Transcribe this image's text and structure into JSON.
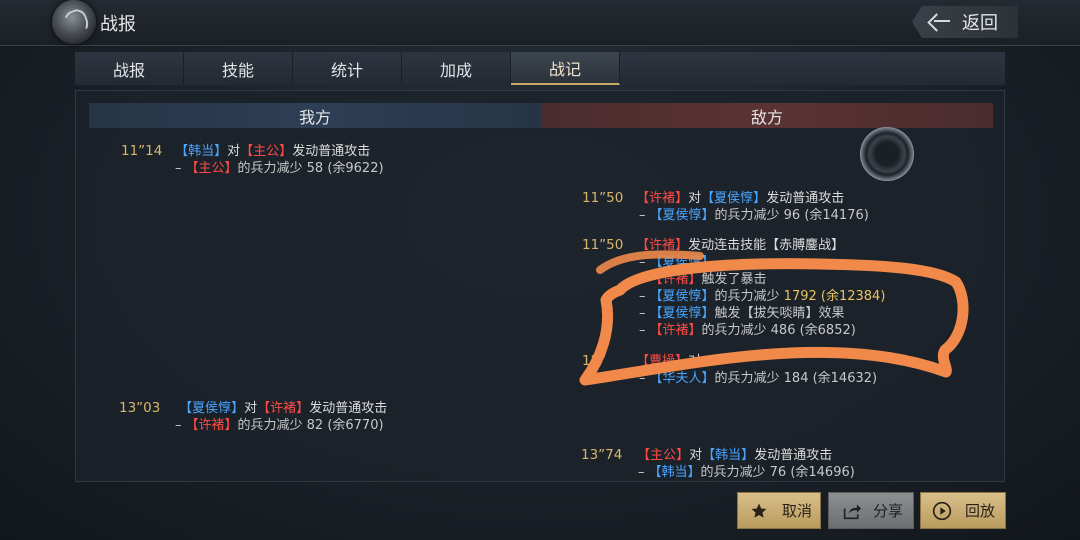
{
  "header": {
    "title": "战报",
    "back_label": "返回"
  },
  "tabs": [
    {
      "label": "战报",
      "active": false
    },
    {
      "label": "技能",
      "active": false
    },
    {
      "label": "统计",
      "active": false
    },
    {
      "label": "加成",
      "active": false
    },
    {
      "label": "战记",
      "active": true
    }
  ],
  "sides": {
    "ours": "我方",
    "enemy": "敌方"
  },
  "log": {
    "e1": {
      "time": "11”14",
      "l1": {
        "a": "【韩当】",
        "b": "对",
        "c": "【主公】",
        "d": "发动普通攻击"
      },
      "l2": {
        "dash": "–",
        "a": "【主公】",
        "b": "的兵力减少 58 (余9622)"
      }
    },
    "e2": {
      "time": "11”50",
      "l1": {
        "a": "【许褚】",
        "b": "对",
        "c": "【夏侯惇】",
        "d": "发动普通攻击"
      },
      "l2": {
        "dash": "–",
        "a": "【夏侯惇】",
        "b": "的兵力减少 96 (余14176)"
      }
    },
    "e3": {
      "time": "11”50",
      "l1": {
        "a": "【许褚】",
        "b": "发动连击技能【赤膊鏖战】"
      },
      "l2": {
        "dash": "–",
        "a": "【夏侯惇】"
      },
      "l3": {
        "dash": "–",
        "a": "【许褚】",
        "b": "触发了暴击"
      },
      "l4": {
        "dash": "–",
        "a": "【夏侯惇】",
        "b": "的兵力减少",
        "c": "1792",
        "d": "(余12384)"
      },
      "l5": {
        "dash": "–",
        "a": "【夏侯惇】",
        "b": "触发【拔矢啖睛】效果"
      },
      "l6": {
        "dash": "–",
        "a": "【许褚】",
        "b": "的兵力减少 486 (余6852)"
      }
    },
    "e4": {
      "time": "12”",
      "l1": {
        "a": "【曹操】",
        "b": "对"
      },
      "l2": {
        "dash": "–",
        "a": "【华夫人】",
        "b": "的兵力减少 184 (余14632)"
      }
    },
    "e5": {
      "time": "13”03",
      "l1": {
        "a": "【夏侯惇】",
        "b": "对",
        "c": "【许褚】",
        "d": "发动普通攻击"
      },
      "l2": {
        "dash": "–",
        "a": "【许褚】",
        "b": "的兵力减少 82 (余6770)"
      }
    },
    "e6": {
      "time": "13”74",
      "l1": {
        "a": "【主公】",
        "b": "对",
        "c": "【韩当】",
        "d": "发动普通攻击"
      },
      "l2": {
        "dash": "–",
        "a": "【韩当】",
        "b": "的兵力减少 76 (余14696)"
      }
    }
  },
  "buttons": {
    "cancel": {
      "label": "取消",
      "icon": "star-icon"
    },
    "share": {
      "label": "分享",
      "icon": "share-icon"
    },
    "replay": {
      "label": "回放",
      "icon": "play-icon"
    }
  },
  "colors": {
    "ally_name": "#4aa6ff",
    "enemy_name": "#ff4b45",
    "time": "#d8b66e",
    "highlight_value": "#e8c463",
    "annotation": "#f0894a"
  }
}
